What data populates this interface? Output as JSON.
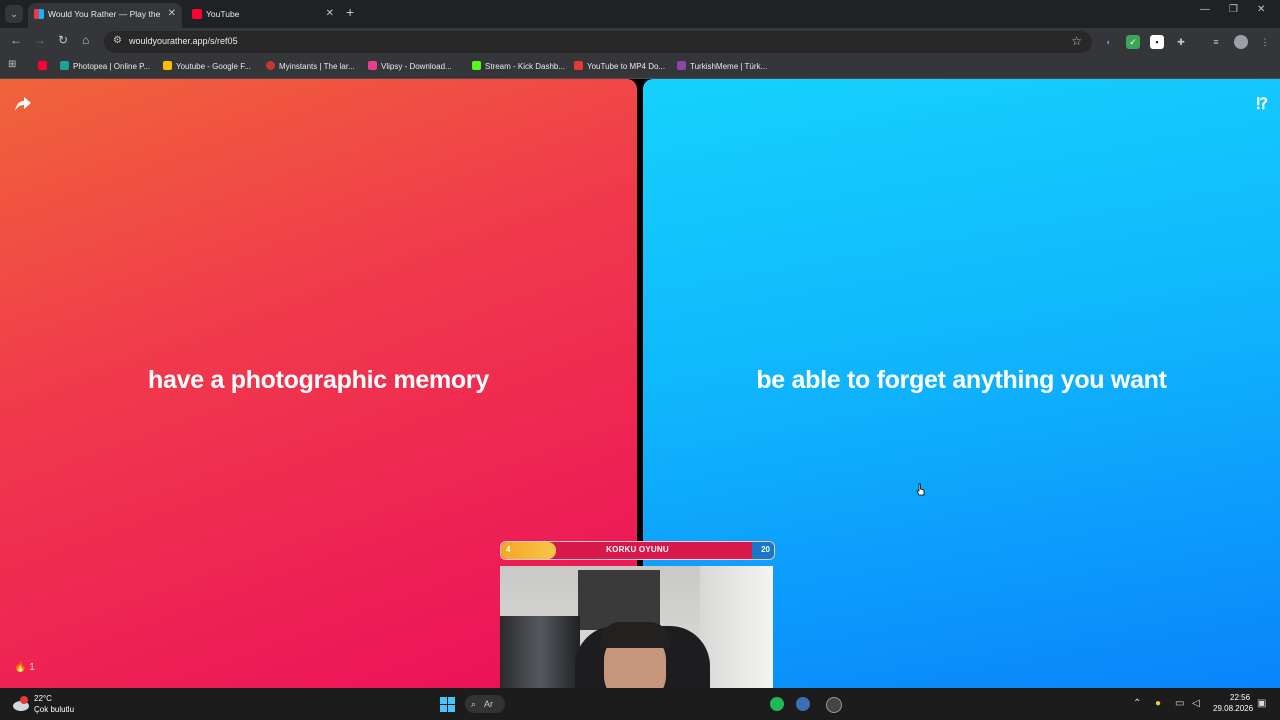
{
  "browser": {
    "tabs": [
      {
        "title": "Would You Rather — Play the G",
        "active": true
      },
      {
        "title": "YouTube",
        "active": false
      }
    ],
    "url": "wouldyourather.app/s/ref05",
    "bookmarks": [
      {
        "label": ""
      },
      {
        "label": "Photopea | Online P..."
      },
      {
        "label": "Youtube - Google F..."
      },
      {
        "label": "Myinstants | The lar..."
      },
      {
        "label": "Vlipsy - Download..."
      },
      {
        "label": "Stream - Kick Dashb..."
      },
      {
        "label": "YouTube to MP4 Do..."
      },
      {
        "label": "TurkishMeme | Türk..."
      }
    ]
  },
  "game": {
    "option_left": "have a photographic memory",
    "option_right": "be able to forget anything you want",
    "votes_count": "1",
    "colors": {
      "left": "#f03a4c",
      "right": "#10b6fc"
    }
  },
  "stream_overlay": {
    "left_count": "4",
    "title": "KORKU OYUNU",
    "right_count": "20",
    "progress_fraction": 0.2
  },
  "taskbar": {
    "weather_temp": "22°C",
    "weather_desc": "Çok bulutlu",
    "search_text": "Ar",
    "time": "22:56",
    "date": "29.08.2026"
  }
}
